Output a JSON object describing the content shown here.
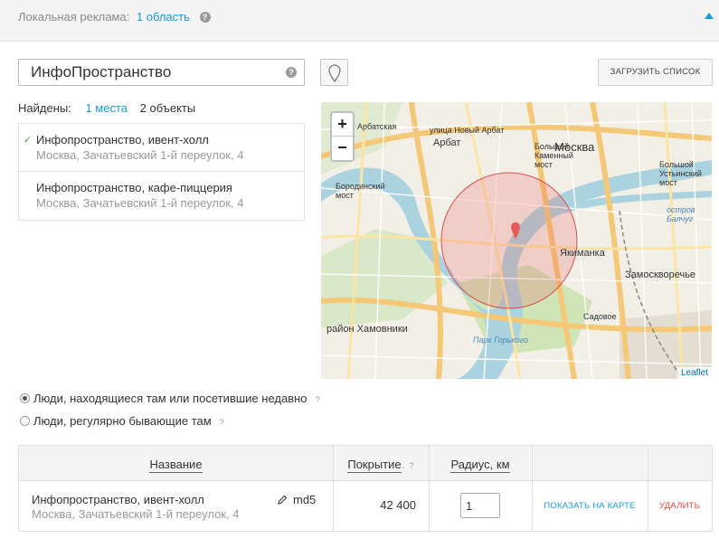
{
  "header": {
    "label": "Локальная реклама:",
    "areas_link": "1 область",
    "help": "?"
  },
  "search": {
    "value": "ИнфоПространство",
    "help": "?"
  },
  "toolbar": {
    "load_list": "ЗАГРУЗИТЬ СПИСОК"
  },
  "found": {
    "label": "Найдены:",
    "places_link": "1 места",
    "objects": "2 объекты"
  },
  "results": [
    {
      "title": "Инфопространство, ивент-холл",
      "address": "Москва, Зачатьевский 1-й переулок, 4",
      "selected": true
    },
    {
      "title": "Инфопространство, кафе-пиццерия",
      "address": "Москва, Зачатьевский 1-й переулок, 4",
      "selected": false
    }
  ],
  "map": {
    "zoom_in": "+",
    "zoom_out": "−",
    "attribution": "Leaflet",
    "labels": {
      "arbat": "Арбат",
      "moskva": "Москва",
      "bolshoy_kamenny": "Большой\nКаменный\nмост",
      "yakimanka": "Якиманка",
      "zamoskvorechye": "Замоскворечье",
      "khamovniki": "район Хамовники",
      "park": "Парк Горького",
      "borodinsky": "Бородинский\nмост",
      "ostrov": "остров\nБалчуг",
      "ustinsky": "Большой\nУстьинский\nмост",
      "old_arbat": "улица Новый Арбат",
      "arbatskaya": "Арбатская",
      "sadovoe": "Садовое"
    },
    "colors": {
      "circle": "#e85a5a",
      "river": "#aad3df",
      "road": "#f5c877",
      "water_text": "#4e87b8"
    }
  },
  "audience": {
    "options": [
      {
        "label": "Люди, находящиеся там или посетившие недавно",
        "checked": true
      },
      {
        "label": "Люди, регулярно бывающие там",
        "checked": false
      }
    ],
    "help": "?"
  },
  "table": {
    "headers": {
      "name": "Название",
      "coverage": "Покрытие",
      "coverage_help": "?",
      "radius": "Радиус, км"
    },
    "rows": [
      {
        "title": "Инфопространство, ивент-холл",
        "address": "Москва, Зачатьевский 1-й переулок, 4",
        "edit": "md5",
        "coverage": "42 400",
        "radius": "1",
        "show_map": "ПОКАЗАТЬ НА КАРТЕ",
        "delete": "УДАЛИТЬ"
      }
    ]
  }
}
